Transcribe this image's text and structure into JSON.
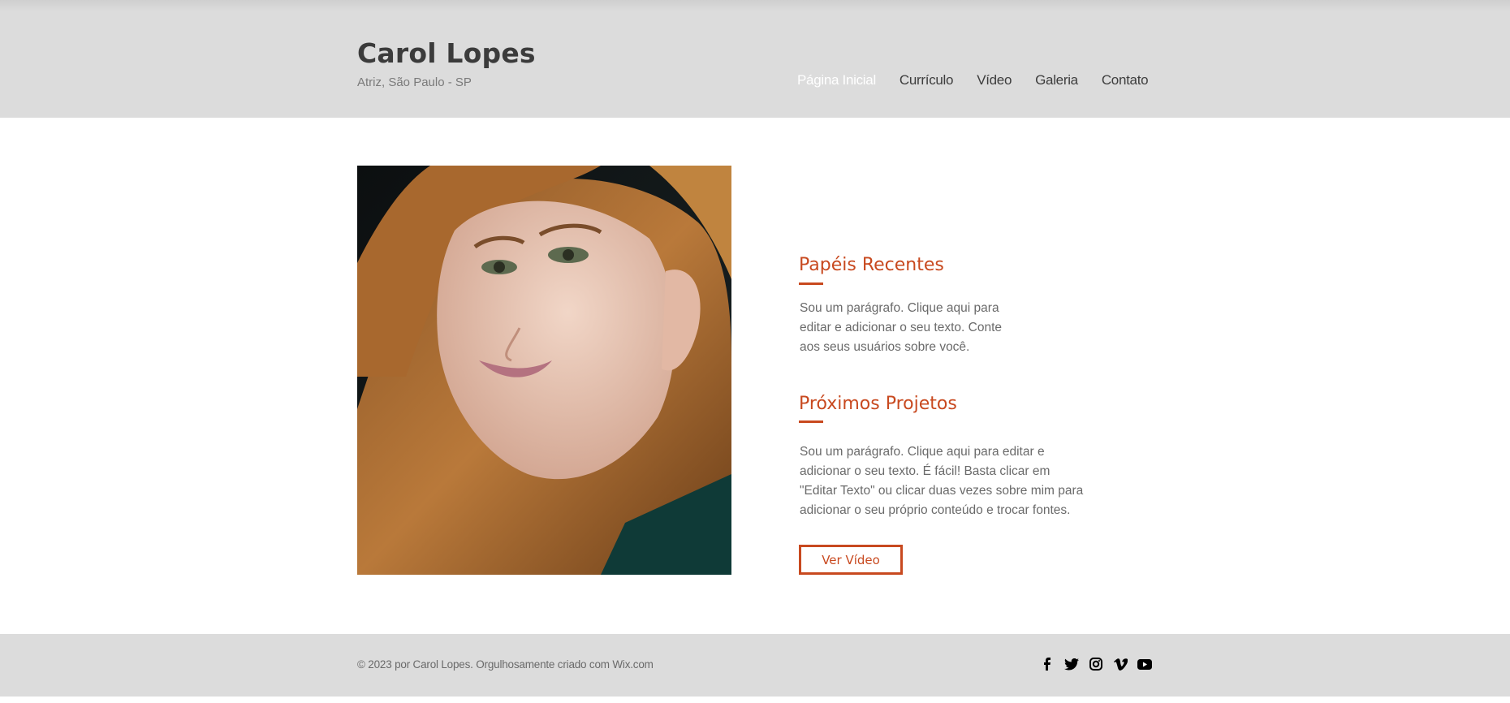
{
  "header": {
    "title": "Carol Lopes",
    "subtitle": "Atriz, São Paulo - SP",
    "nav": [
      {
        "label": "Página Inicial",
        "active": true
      },
      {
        "label": "Currículo"
      },
      {
        "label": "Vídeo"
      },
      {
        "label": "Galeria"
      },
      {
        "label": "Contato"
      }
    ]
  },
  "main": {
    "portrait_alt": "portrait photo",
    "recent": {
      "title": "Papéis Recentes",
      "text_lines": [
        "Sou um parágrafo. Clique aqui para",
        "editar e adicionar o seu texto. Conte",
        "aos seus usuários sobre você."
      ]
    },
    "upcoming": {
      "title": "Próximos Projetos",
      "text_lines": [
        "Sou um parágrafo. Clique aqui para editar e",
        "adicionar o seu texto. É fácil! Basta clicar em",
        "\"Editar Texto\" ou clicar duas vezes sobre mim para",
        "adicionar o seu próprio conteúdo e trocar fontes."
      ]
    },
    "cta_label": "Ver Vídeo"
  },
  "footer": {
    "copyright": "© 2023 por Carol Lopes. Orgulhosamente criado com Wix.com",
    "social": [
      "facebook-icon",
      "twitter-icon",
      "instagram-icon",
      "vimeo-icon",
      "youtube-icon"
    ]
  },
  "colors": {
    "accent": "#c8491f",
    "header_bg": "#dcdcdc",
    "footer_bg": "#dcdcdc"
  }
}
